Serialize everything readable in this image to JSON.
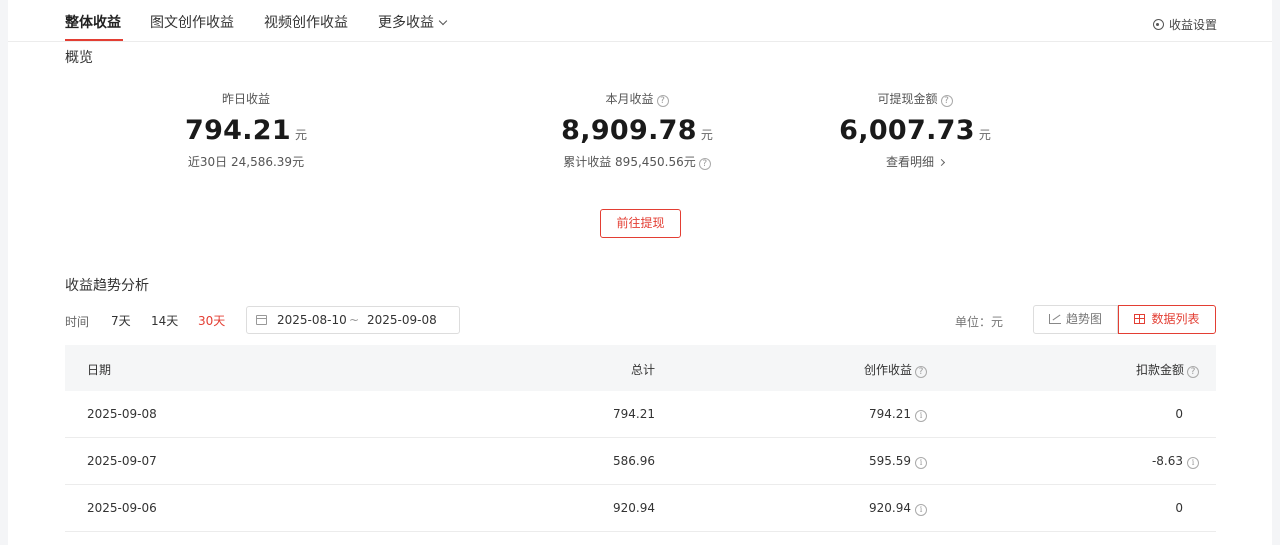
{
  "tabs": [
    {
      "label": "整体收益",
      "active": true
    },
    {
      "label": "图文创作收益",
      "active": false
    },
    {
      "label": "视频创作收益",
      "active": false
    },
    {
      "label": "更多收益",
      "active": false,
      "dropdown": true
    }
  ],
  "settings": {
    "label": "收益设置",
    "icon": "settings-ring-icon"
  },
  "overview": {
    "title": "概览",
    "yesterday": {
      "label": "昨日收益",
      "value": "794.21",
      "unit": "元",
      "sub": "近30日 24,586.39元"
    },
    "month": {
      "label": "本月收益",
      "value": "8,909.78",
      "unit": "元",
      "sub": "累计收益 895,450.56元"
    },
    "withdrawable": {
      "label": "可提现金额",
      "value": "6,007.73",
      "unit": "元",
      "sub": "查看明细"
    },
    "withdraw_button": "前往提现"
  },
  "trend": {
    "title": "收益趋势分析",
    "time_label": "时间",
    "ranges": [
      "7天",
      "14天",
      "30天"
    ],
    "active_range": "30天",
    "date_start": "2025-08-10",
    "date_sep": "~",
    "date_end": "2025-09-08",
    "unit_label": "单位：元",
    "view_trend": "趋势图",
    "view_list": "数据列表",
    "active_view": "数据列表"
  },
  "table": {
    "headers": {
      "date": "日期",
      "total": "总计",
      "creation": "创作收益",
      "deduction": "扣款金额"
    },
    "rows": [
      {
        "date": "2025-09-08",
        "total": "794.21",
        "creation": "794.21",
        "deduction": "0",
        "deduction_info": false
      },
      {
        "date": "2025-09-07",
        "total": "586.96",
        "creation": "595.59",
        "deduction": "-8.63",
        "deduction_info": true
      },
      {
        "date": "2025-09-06",
        "total": "920.94",
        "creation": "920.94",
        "deduction": "0",
        "deduction_info": false
      }
    ]
  },
  "colors": {
    "accent": "#e33e33",
    "header_bg": "#f5f6f7",
    "border": "#ececec"
  }
}
